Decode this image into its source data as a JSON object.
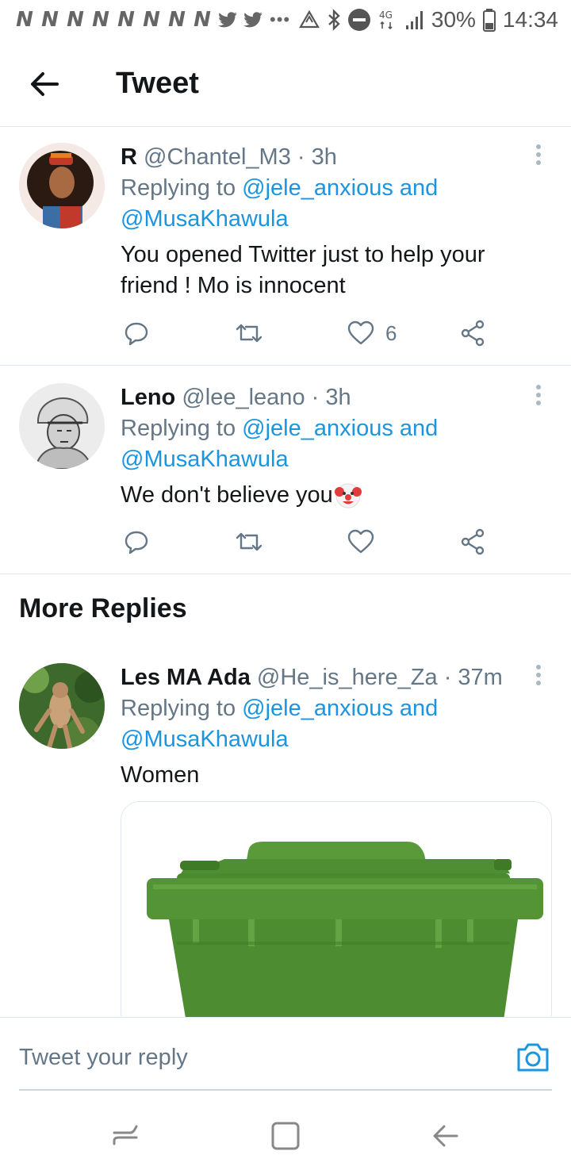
{
  "status_bar": {
    "notif_glyph": "N",
    "battery": "30%",
    "time": "14:34",
    "network": "4G"
  },
  "header": {
    "title": "Tweet"
  },
  "tweets": [
    {
      "name": "R",
      "handle": "@Chantel_M3",
      "time": "· 3h",
      "replying_prefix": "Replying to",
      "mention1": "@jele_anxious and",
      "mention2": "@MusaKhawula",
      "text": "You opened Twitter just to help your friend ! Mo is innocent",
      "like_count": "6"
    },
    {
      "name": "Leno",
      "handle": "@lee_leano",
      "time": "· 3h",
      "replying_prefix": "Replying to",
      "mention1": "@jele_anxious and",
      "mention2": "@MusaKhawula",
      "text": "We don't believe you",
      "like_count": ""
    },
    {
      "name": "Les MA Ada",
      "handle": "@He_is_here_Za",
      "time": "· 37m",
      "replying_prefix": "Replying to",
      "mention1": "@jele_anxious and",
      "mention2": "@MusaKhawula",
      "text": "Women"
    }
  ],
  "section": {
    "more_replies": "More Replies"
  },
  "reply_bar": {
    "placeholder": "Tweet your reply"
  },
  "colors": {
    "accent": "#1b95e0",
    "secondary_text": "#657786",
    "divider": "#e1e8ed",
    "bin_green": "#4a8a2e"
  },
  "icons": {
    "back": "arrow-left-icon",
    "more": "more-vertical-icon",
    "reply": "reply-icon",
    "retweet": "retweet-icon",
    "like": "heart-icon",
    "share": "share-icon",
    "camera": "camera-icon",
    "clown": "clown-face-emoji"
  }
}
